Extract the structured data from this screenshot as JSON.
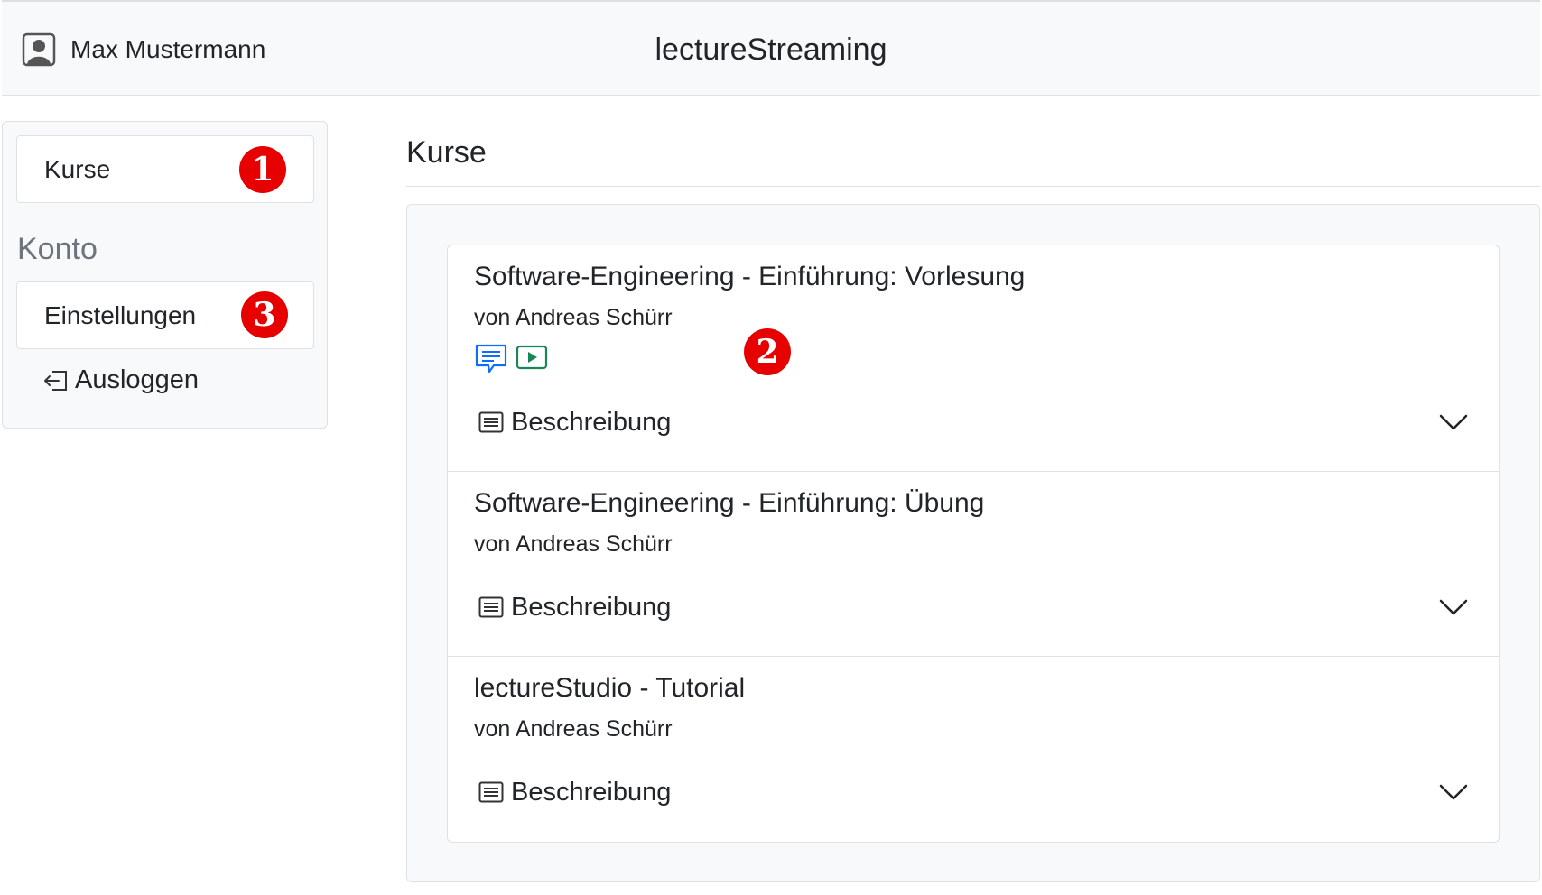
{
  "header": {
    "user_name": "Max Mustermann",
    "app_title": "lectureStreaming"
  },
  "sidebar": {
    "courses_label": "Kurse",
    "account_heading": "Konto",
    "settings_label": "Einstellungen",
    "logout_label": "Ausloggen"
  },
  "markers": [
    "1",
    "2",
    "3"
  ],
  "main": {
    "heading": "Kurse",
    "courses": [
      {
        "title": "Software-Engineering - Einführung: Vorlesung",
        "author": "von Andreas Schürr",
        "icons": [
          "chat-icon",
          "play-icon"
        ],
        "description_label": "Beschreibung"
      },
      {
        "title": "Software-Engineering - Einführung: Übung",
        "author": "von Andreas Schürr",
        "description_label": "Beschreibung"
      },
      {
        "title": "lectureStudio - Tutorial",
        "author": "von Andreas Schürr",
        "description_label": "Beschreibung"
      }
    ]
  },
  "colors": {
    "marker": "#e60000",
    "chat_icon": "#0d6efd",
    "play_icon": "#198754",
    "muted": "#6c757d"
  }
}
